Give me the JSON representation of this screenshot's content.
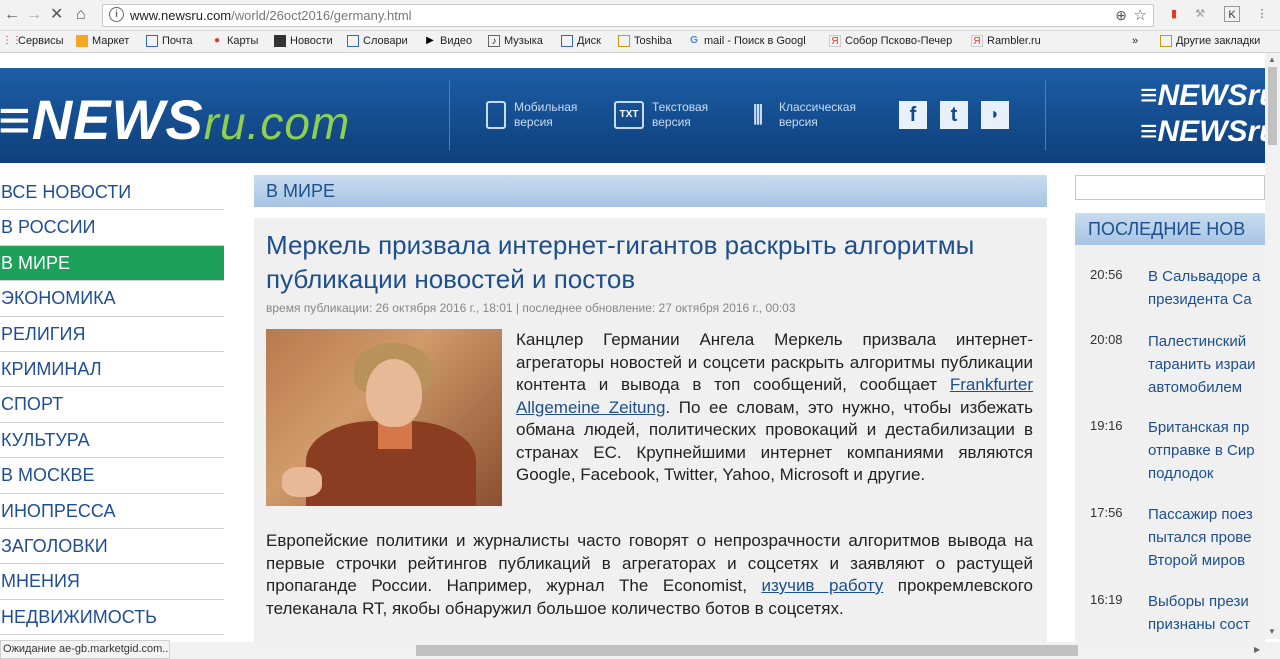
{
  "browser": {
    "url_host": "www.newsru.com",
    "url_path": "/world/26oct2016/germany.html",
    "bookmarks": [
      "Сервисы",
      "Маркет",
      "Почта",
      "Карты",
      "Новости",
      "Словари",
      "Видео",
      "Музыка",
      "Диск",
      "Toshiba",
      "mail - Поиск в Googl",
      "Собор Псково-Печер",
      "Rambler.ru"
    ],
    "bookmarks_more": "»",
    "other_bookmarks": "Другие закладки",
    "status": "Ожидание ae-gb.marketgid.com..."
  },
  "header": {
    "logo_main": "NEWS",
    "logo_suffix": "ru.com",
    "mobile_line1": "Мобильная",
    "mobile_line2": "версия",
    "text_line1": "Текстовая",
    "text_line2": "версия",
    "text_icon": "TXT",
    "classic_line1": "Классическая",
    "classic_line2": "версия",
    "right_logo_1": "NEWSru",
    "right_logo_2": "NEWSru"
  },
  "nav": [
    "ВСЕ НОВОСТИ",
    "В РОССИИ",
    "В МИРЕ",
    "ЭКОНОМИКА",
    "РЕЛИГИЯ",
    "КРИМИНАЛ",
    "СПОРТ",
    "КУЛЬТУРА",
    "В МОСКВЕ",
    "ИНОПРЕССА",
    "ЗАГОЛОВКИ",
    "МНЕНИЯ",
    "НЕДВИЖИМОСТЬ"
  ],
  "active_nav": "В МИРЕ",
  "section": "В МИРЕ",
  "article": {
    "headline": "Меркель призвала интернет-гигантов раскрыть алгоритмы публикации новостей и постов",
    "meta": "время публикации: 26 октября 2016 г., 18:01 | последнее обновление: 27 октября 2016 г., 00:03",
    "lead_1": "Канцлер Германии Ангела Меркель призвала интернет-агрегаторы новостей и соцсети раскрыть алгоритмы публикации контента и вывода в топ сообщений, сообщает ",
    "lead_link": "Frankfurter Allgemeine Zeitung",
    "lead_2": ". По ее словам, это нужно, чтобы избежать обмана людей, политических провокаций и дестабилизации в странах ЕС. Крупнейшими интернет компаниями являются Google, Facebook, Twitter, Yahoo, Microsoft и другие.",
    "body_1": "Европейские политики и журналисты часто говорят о непрозрачности алгоритмов вывода на первые строчки рейтингов публикаций в агрегаторах и соцсетях и заявляют о растущей пропаганде России. Например, журнал The Economist, ",
    "body_link": "изучив работу",
    "body_2": " прокремлевского телеканала RT, якобы обнаружил большое количество ботов в соцсетях."
  },
  "latest": {
    "title": "ПОСЛЕДНИЕ НОВ",
    "items": [
      {
        "time": "20:56",
        "line1": "В Сальвадоре а",
        "line2": "президента Са"
      },
      {
        "time": "20:08",
        "line1": "Палестинский",
        "line2": "таранить израи",
        "line3": "автомобилем"
      },
      {
        "time": "19:16",
        "line1": "Британская пр",
        "line2": "отправке в Сир",
        "line3": "подлодок"
      },
      {
        "time": "17:56",
        "line1": "Пассажир поез",
        "line2": "пытался прове",
        "line3": "Второй миров"
      },
      {
        "time": "16:19",
        "line1": "Выборы прези",
        "line2": "признаны сост"
      }
    ]
  },
  "colors": {
    "header_blue": "#1d5ea6",
    "active_green": "#1da05a",
    "link_blue": "#1d4f8e"
  }
}
